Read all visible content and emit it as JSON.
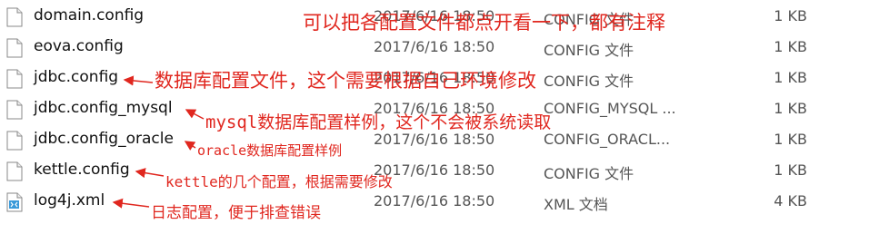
{
  "files": [
    {
      "name": "domain.config",
      "date": "2017/6/16 18:50",
      "type": "CONFIG 文件",
      "size": "1 KB",
      "icon": "file-icon"
    },
    {
      "name": "eova.config",
      "date": "2017/6/16 18:50",
      "type": "CONFIG 文件",
      "size": "1 KB",
      "icon": "file-icon"
    },
    {
      "name": "jdbc.config",
      "date": "2017/6/16 18:50",
      "type": "CONFIG 文件",
      "size": "1 KB",
      "icon": "file-icon"
    },
    {
      "name": "jdbc.config_mysql",
      "date": "2017/6/16 18:50",
      "type": "CONFIG_MYSQL ...",
      "size": "1 KB",
      "icon": "file-icon"
    },
    {
      "name": "jdbc.config_oracle",
      "date": "2017/6/16 18:50",
      "type": "CONFIG_ORACL...",
      "size": "1 KB",
      "icon": "file-icon"
    },
    {
      "name": "kettle.config",
      "date": "2017/6/16 18:50",
      "type": "CONFIG 文件",
      "size": "1 KB",
      "icon": "file-icon"
    },
    {
      "name": "log4j.xml",
      "date": "2017/6/16 18:50",
      "type": "XML 文档",
      "size": "4 KB",
      "icon": "xml-file-icon"
    }
  ],
  "annotations": {
    "top": "可以把各配置文件都点开看一下，都有注释",
    "jdbc": "数据库配置文件，这个需要根据自己环境修改",
    "mysql": "mysql数据库配置样例，这个不会被系统读取",
    "oracle": "oracle数据库配置样例",
    "kettle": "kettle的几个配置，根据需要修改",
    "log4j": "日志配置，便于排查错误"
  },
  "colors": {
    "annotation": "#e0271f"
  }
}
